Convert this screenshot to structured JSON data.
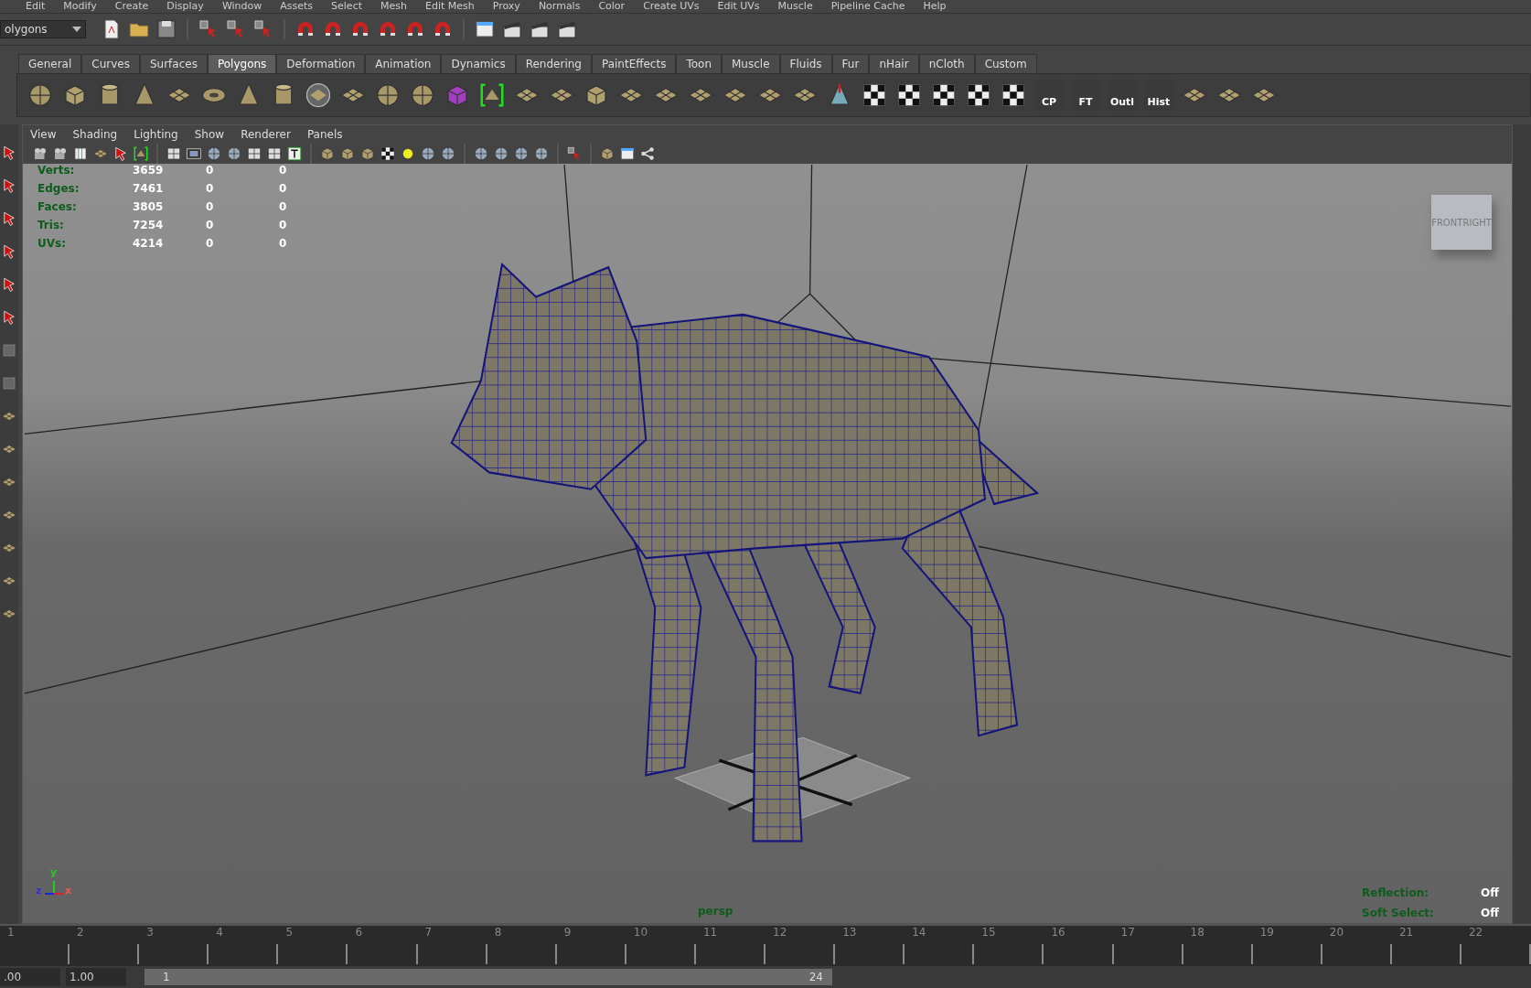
{
  "menu_bar": [
    "Edit",
    "Modify",
    "Create",
    "Display",
    "Window",
    "Assets",
    "Select",
    "Mesh",
    "Edit Mesh",
    "Proxy",
    "Normals",
    "Color",
    "Create UVs",
    "Edit UVs",
    "Muscle",
    "Pipeline Cache",
    "Help"
  ],
  "mode_dropdown": "olygons",
  "shelf_tabs": [
    {
      "label": "General",
      "selected": false
    },
    {
      "label": "Curves",
      "selected": false
    },
    {
      "label": "Surfaces",
      "selected": false
    },
    {
      "label": "Polygons",
      "selected": true
    },
    {
      "label": "Deformation",
      "selected": false
    },
    {
      "label": "Animation",
      "selected": false
    },
    {
      "label": "Dynamics",
      "selected": false
    },
    {
      "label": "Rendering",
      "selected": false
    },
    {
      "label": "PaintEffects",
      "selected": false
    },
    {
      "label": "Toon",
      "selected": false
    },
    {
      "label": "Muscle",
      "selected": false
    },
    {
      "label": "Fluids",
      "selected": false
    },
    {
      "label": "Fur",
      "selected": false
    },
    {
      "label": "nHair",
      "selected": false
    },
    {
      "label": "nCloth",
      "selected": false
    },
    {
      "label": "Custom",
      "selected": false
    }
  ],
  "shelf_labels": [
    "CP",
    "FT",
    "Outl",
    "Hist"
  ],
  "panel_menu": [
    "View",
    "Shading",
    "Lighting",
    "Show",
    "Renderer",
    "Panels"
  ],
  "hud_stats": [
    {
      "label": "Verts:",
      "values": [
        "3659",
        "0",
        "0"
      ]
    },
    {
      "label": "Edges:",
      "values": [
        "7461",
        "0",
        "0"
      ]
    },
    {
      "label": "Faces:",
      "values": [
        "3805",
        "0",
        "0"
      ]
    },
    {
      "label": "Tris:",
      "values": [
        "7254",
        "0",
        "0"
      ]
    },
    {
      "label": "UVs:",
      "values": [
        "4214",
        "0",
        "0"
      ]
    }
  ],
  "view_cube": [
    "FRONT",
    "RIGHT"
  ],
  "axis_labels": [
    "y",
    "z",
    "x"
  ],
  "camera_name": "persp",
  "hud_bottom": [
    {
      "label": "Reflection:",
      "value": "Off"
    },
    {
      "label": "Soft Select:",
      "value": "Off"
    }
  ],
  "timeline_ticks": [
    "1",
    "2",
    "3",
    "4",
    "5",
    "6",
    "7",
    "8",
    "9",
    "10",
    "11",
    "12",
    "13",
    "14",
    "15",
    "16",
    "17",
    "18",
    "19",
    "20",
    "21",
    "22"
  ],
  "range": {
    "start_field": ".00",
    "current_field": "1.00",
    "range_start": "1",
    "range_end": "24"
  }
}
